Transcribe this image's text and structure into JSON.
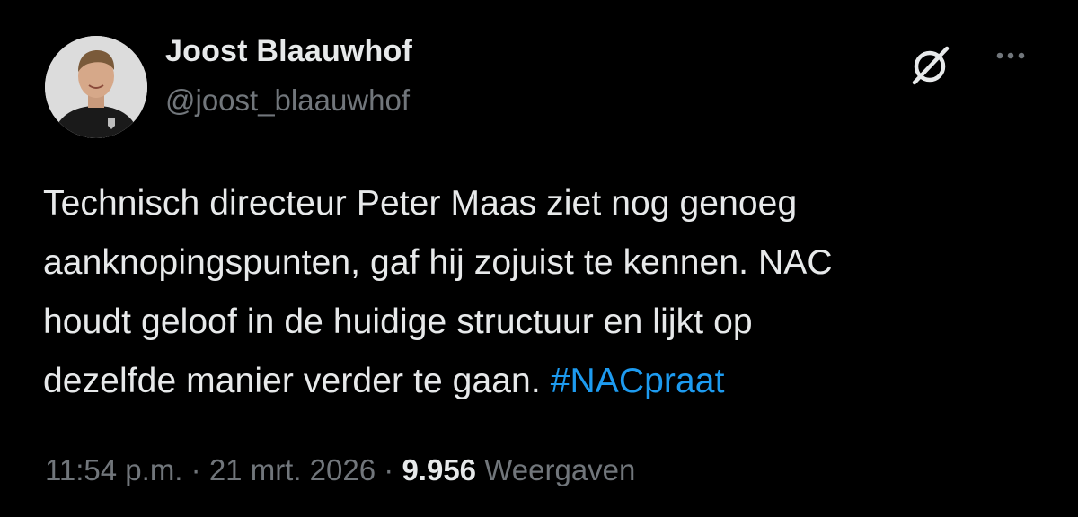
{
  "author": {
    "display_name": "Joost Blaauwhof",
    "handle": "@joost_blaauwhof"
  },
  "header_icons": {
    "grok": "grok-slash-icon",
    "more": "more-horizontal-icon"
  },
  "tweet": {
    "text": "Technisch directeur Peter Maas ziet nog genoeg\naanknopingspunten, gaf hij zojuist te kennen. NAC\nhoudt geloof in de huidige structuur en lijkt op\ndezelfde manier verder te gaan. ",
    "hashtag": "#NACpraat"
  },
  "meta": {
    "time": "11:54 p.m.",
    "separator": "·",
    "date": "21 mrt. 2026",
    "views_count": "9.956",
    "views_label": "Weergaven"
  },
  "colors": {
    "background": "#000000",
    "text": "#e7e9ea",
    "secondary": "#71767b",
    "link": "#1d9bf0"
  }
}
